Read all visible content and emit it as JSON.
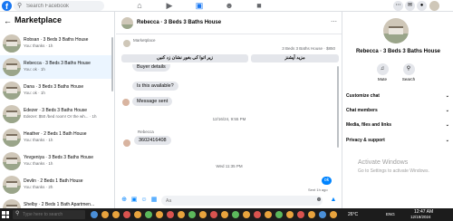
{
  "topbar": {
    "logo": "f",
    "search_placeholder": "Search Facebook",
    "nav_icons": [
      "home-icon",
      "video-icon",
      "marketplace-icon",
      "groups-icon",
      "gaming-icon"
    ],
    "right_icons": [
      "menu-icon",
      "messenger-icon",
      "notifications-icon",
      "profile-icon"
    ]
  },
  "sidebar": {
    "title": "Marketplace",
    "conversations": [
      {
        "name": "Robsan · 3 Beds 3 Baths House",
        "preview": "You: thanks · 1h",
        "active": false
      },
      {
        "name": "Rebecca · 3 Beds 3 Baths House",
        "preview": "You: ok · 1h",
        "active": true
      },
      {
        "name": "Dana · 3 Beds 3 Baths House",
        "preview": "You: ok · 1h",
        "active": false
      },
      {
        "name": "Edezer · 3 Beds 3 Baths House",
        "preview": "Edezer: $50 /bed room! Or the wh... · 1h",
        "active": false
      },
      {
        "name": "Heather · 2 Beds 1 Bath House",
        "preview": "You: thanks · 1h",
        "active": false
      },
      {
        "name": "Yevgeniya · 3 Beds 3 Baths House",
        "preview": "You: thanks · 1h",
        "active": false
      },
      {
        "name": "Devlin · 2 Beds 1 Bath House",
        "preview": "You: thanks · 2h",
        "active": false
      },
      {
        "name": "Shelby · 2 Beds 1 Bath Apartmen...",
        "preview": "",
        "active": false
      }
    ]
  },
  "chat": {
    "title": "Rebecca · 3 Beds 3 Baths House",
    "marketplace_label": "Marketplace",
    "listing": "3 Beds 3 Baths House · $850",
    "btn_left": "زیر اتوا کی بغور نشان زد کنیں",
    "btn_right": "مزید آپشنز",
    "msg_buyer_details": "Buyer details",
    "msg_available": "Is this available?",
    "msg_sent": "Message sent",
    "timestamp1": "12/16/24, 9:55 PM",
    "sender": "Rebecca",
    "msg_number": "3602416408",
    "timestamp2": "Wed 11:35 PM",
    "reply": "ok",
    "sent_status": "Sent 1h ago",
    "composer_placeholder": "Aa"
  },
  "profile": {
    "name": "Rebecca · 3 Beds 3 Baths House",
    "mute_label": "Mute",
    "search_label": "Search",
    "sections": [
      "Customize chat",
      "Chat members",
      "Media, files and links",
      "Privacy & support"
    ]
  },
  "watermark": {
    "line1": "Activate Windows",
    "line2": "Go to Settings to activate Windows."
  },
  "taskbar": {
    "search_placeholder": "Type here to search",
    "weather": "26°C",
    "lang": "ENG",
    "time": "12:47 AM",
    "date": "12/19/2024"
  },
  "colors": {
    "brand": "#1877f2",
    "accent": "#0084ff",
    "active_row": "#ebf5ff"
  }
}
